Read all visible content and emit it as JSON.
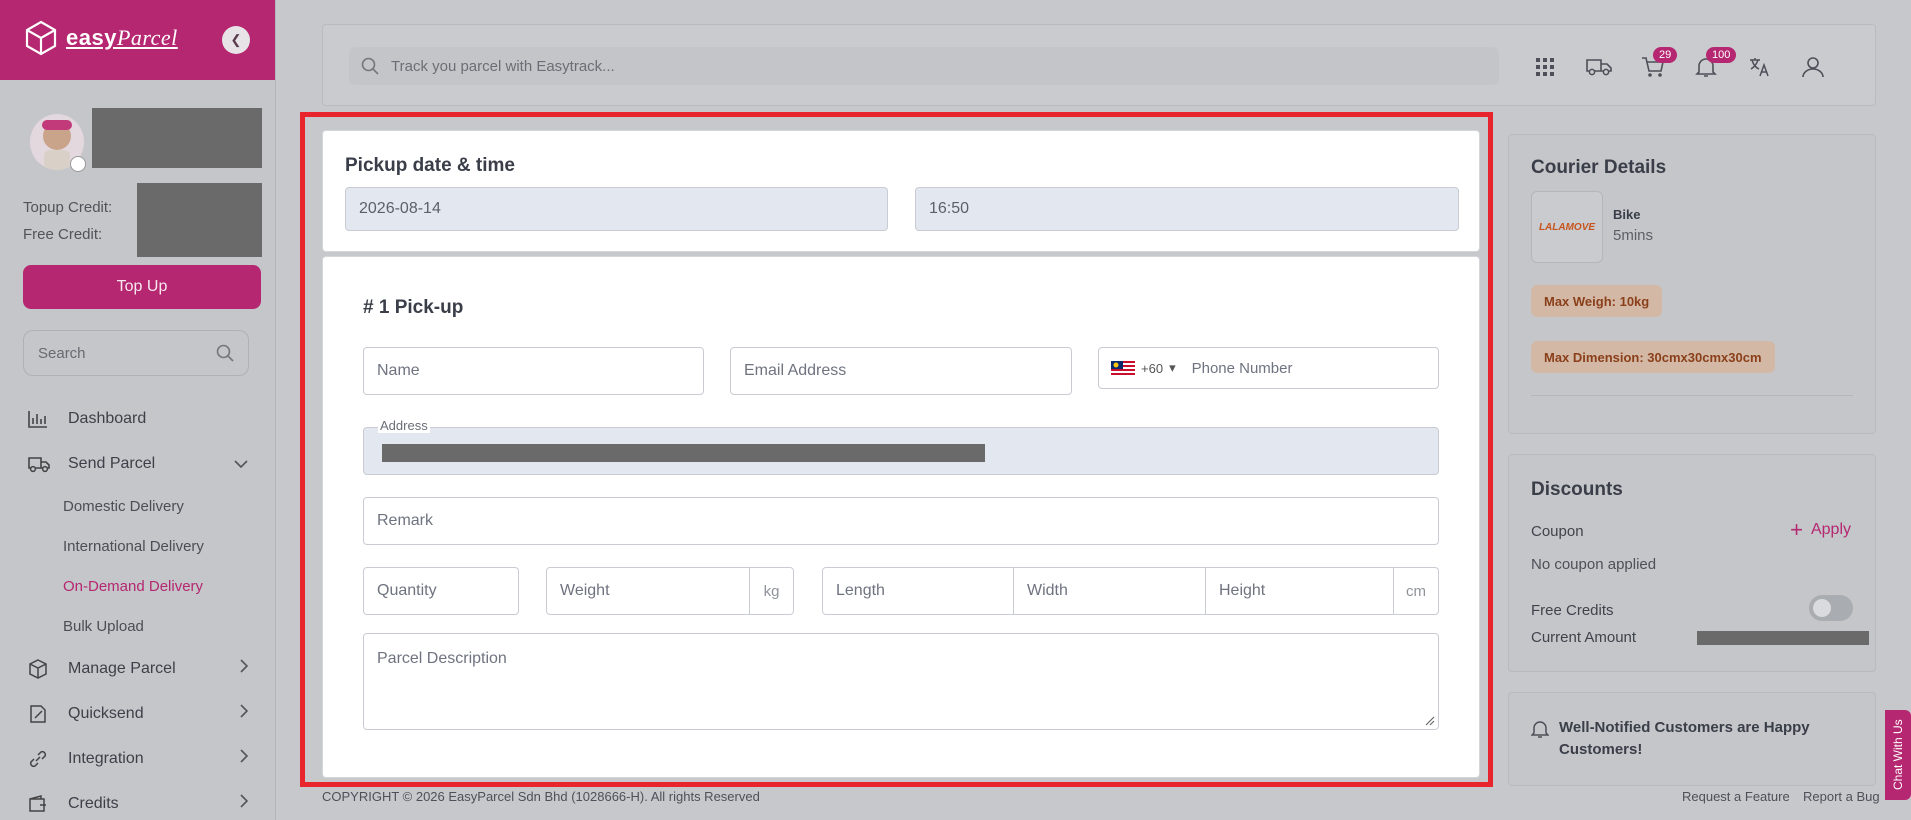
{
  "brand": {
    "logo_text": "easy",
    "logo_script": "Parcel"
  },
  "sidebar": {
    "topup_credit_label": "Topup Credit:",
    "free_credit_label": "Free Credit:",
    "topup_button": "Top Up",
    "search_placeholder": "Search",
    "nav": [
      {
        "label": "Dashboard",
        "icon": "chart-bars-icon"
      },
      {
        "label": "Send Parcel",
        "icon": "truck-icon"
      },
      {
        "label": "Manage Parcel",
        "icon": "box-icon"
      },
      {
        "label": "Quicksend",
        "icon": "quicksend-icon"
      },
      {
        "label": "Integration",
        "icon": "link-icon"
      },
      {
        "label": "Credits",
        "icon": "wallet-icon"
      }
    ],
    "send_parcel_sub": [
      "Domestic Delivery",
      "International Delivery",
      "On-Demand Delivery",
      "Bulk Upload"
    ],
    "active_sub": "On-Demand Delivery"
  },
  "topbar": {
    "track_placeholder": "Track you parcel with Easytrack...",
    "cart_count": "29",
    "notification_count": "100"
  },
  "pickup": {
    "title": "Pickup date & time",
    "date": "2026-08-14",
    "time": "16:50"
  },
  "pickup_form": {
    "title": "# 1 Pick-up",
    "name_placeholder": "Name",
    "email_placeholder": "Email Address",
    "phone_code": "+60",
    "phone_placeholder": "Phone Number",
    "address_label": "Address",
    "remark_placeholder": "Remark",
    "quantity_placeholder": "Quantity",
    "weight_placeholder": "Weight",
    "weight_unit": "kg",
    "length_placeholder": "Length",
    "width_placeholder": "Width",
    "height_placeholder": "Height",
    "dim_unit": "cm",
    "description_placeholder": "Parcel Description"
  },
  "courier": {
    "title": "Courier Details",
    "logo_text": "LALAMOVE",
    "vehicle": "Bike",
    "eta": "5mins",
    "max_weight": "Max Weigh: 10kg",
    "max_dimension": "Max Dimension: 30cmx30cmx30cm"
  },
  "discounts": {
    "title": "Discounts",
    "coupon_label": "Coupon",
    "apply_label": "Apply",
    "coupon_status": "No coupon applied",
    "free_credits_label": "Free Credits",
    "current_amount_label": "Current Amount"
  },
  "notify": {
    "text": "Well-Notified Customers are Happy Customers!"
  },
  "footer": {
    "copyright": "COPYRIGHT © 2026 EasyParcel Sdn Bhd (1028666-H). All rights Reserved",
    "request_feature": "Request a Feature",
    "report_bug": "Report a Bug"
  },
  "chat_tab": "Chat With Us",
  "colors": {
    "brand": "#b52770",
    "highlight": "#e8242d"
  }
}
